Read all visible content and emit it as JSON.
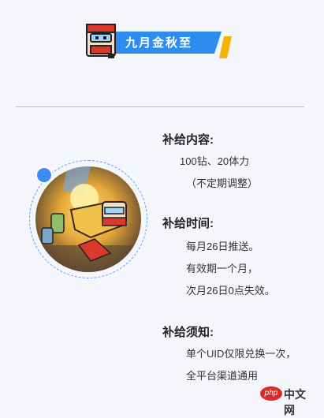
{
  "banner": {
    "title": "九月金秋至"
  },
  "sections": {
    "content_heading": "补给内容:",
    "content_lines": [
      "100钻、20体力",
      "（不定期调整）"
    ],
    "time_heading": "补给时间:",
    "time_lines": [
      "每月26日推送。",
      "有效期一个月，",
      "次月26日0点失效。"
    ],
    "notice_heading": "补给须知:",
    "notice_lines": [
      "单个UID仅限兑换一次，",
      "全平台渠道通用"
    ]
  },
  "watermark": {
    "php": "php",
    "site": "中文网"
  },
  "colors": {
    "accent_blue": "#2d8cf0",
    "accent_yellow": "#f5b400",
    "ring_blue": "#5aa0f2",
    "background": "#f5f6fb"
  }
}
